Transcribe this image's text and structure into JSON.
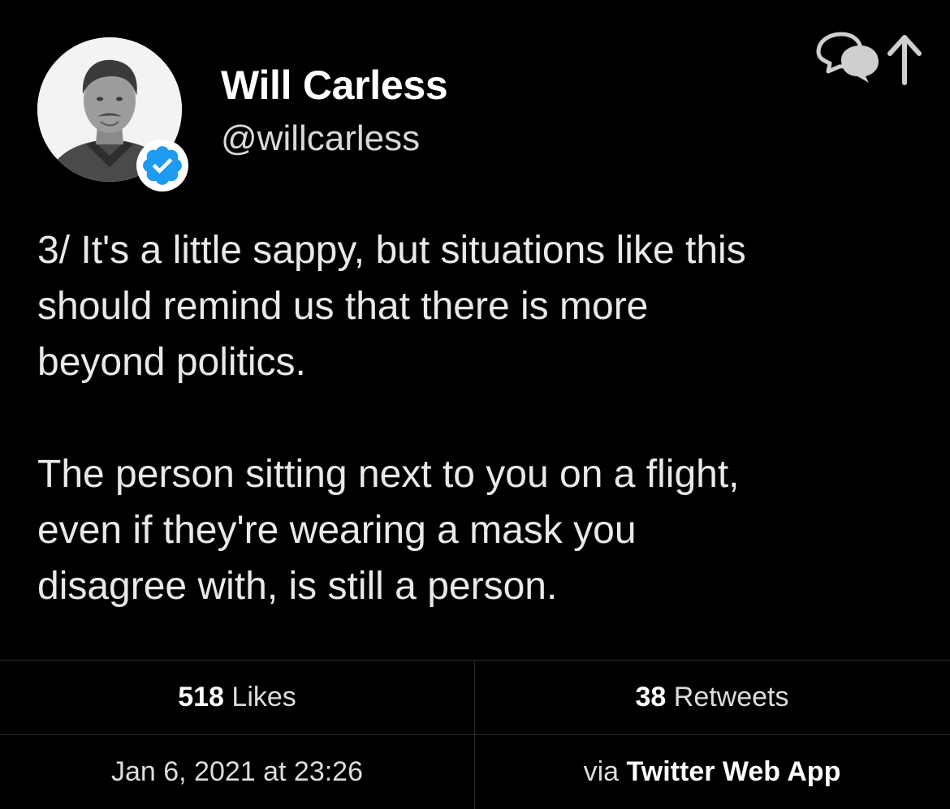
{
  "author": {
    "display_name": "Will Carless",
    "handle": "@willcarless",
    "verified": true,
    "verified_color": "#1d9bf0"
  },
  "header_icons": [
    "conversation-icon",
    "share-arrow-icon"
  ],
  "tweet": {
    "text": "3/ It's a little sappy, but situations like this\nshould remind us that there is more\nbeyond politics.\n\nThe person sitting next to you on a flight,\neven if they're wearing a mask you\ndisagree with, is still a person."
  },
  "stats": {
    "likes_count": "518",
    "likes_label": "Likes",
    "retweets_count": "38",
    "retweets_label": "Retweets"
  },
  "footer": {
    "timestamp": "Jan 6, 2021 at 23:26",
    "via_prefix": "via",
    "source_app": "Twitter Web App"
  },
  "colors": {
    "background": "#000000",
    "text_primary": "#ffffff",
    "text_secondary": "#dcdcdc",
    "divider": "#2a2a2a"
  }
}
